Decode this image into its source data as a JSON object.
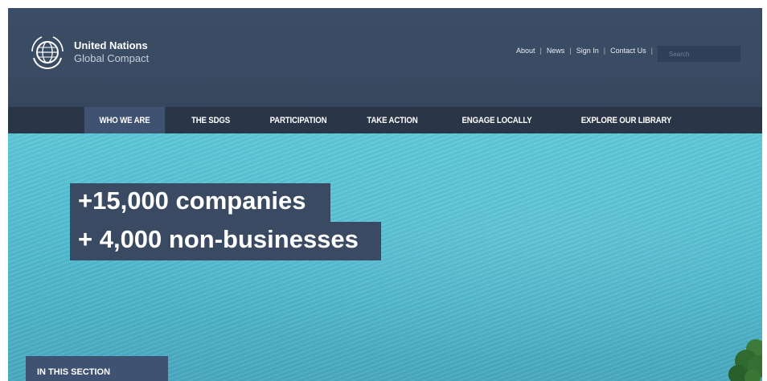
{
  "brand": {
    "line1": "United Nations",
    "line2": "Global Compact",
    "logo_icon": "un-emblem-icon"
  },
  "utility_nav": {
    "items": [
      "About",
      "News",
      "Sign In",
      "Contact Us"
    ],
    "separator": "|"
  },
  "search": {
    "placeholder": "Search",
    "value": ""
  },
  "main_nav": {
    "items": [
      {
        "label": "WHO WE ARE",
        "active": true
      },
      {
        "label": "THE SDGS",
        "active": false
      },
      {
        "label": "PARTICIPATION",
        "active": false
      },
      {
        "label": "TAKE ACTION",
        "active": false
      },
      {
        "label": "ENGAGE LOCALLY",
        "active": false
      },
      {
        "label": "EXPLORE OUR LIBRARY",
        "active": false
      }
    ]
  },
  "hero": {
    "headline_1": "+15,000 companies",
    "headline_2": "+ 4,000 non-businesses"
  },
  "section": {
    "tab_label": "IN THIS SECTION"
  },
  "colors": {
    "header_bg": "#3b4d66",
    "nav_bg": "#2a3647",
    "active_nav": "#3f5271",
    "hero_water": "#54bdd0",
    "headline_bg": "#3a4a63"
  }
}
